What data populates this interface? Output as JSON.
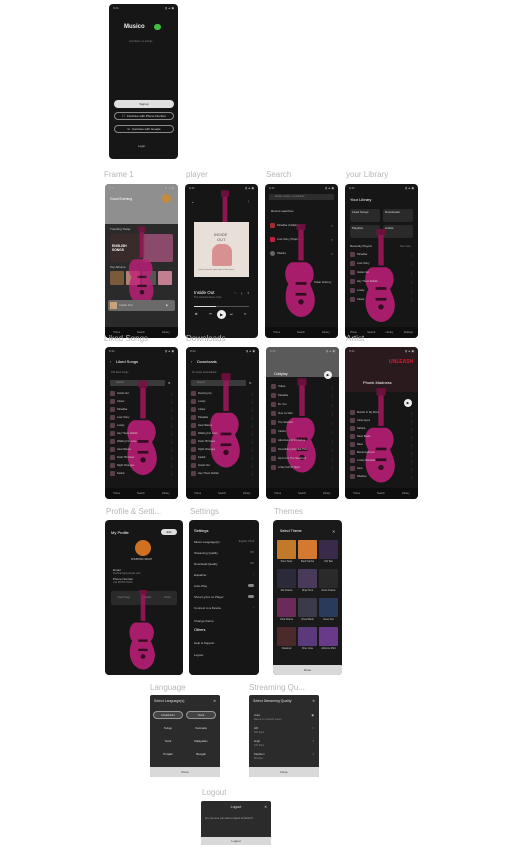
{
  "status": {
    "time": "9:41",
    "icons": "▮ ▲ ◼"
  },
  "frame1": {
    "app_name": "Musico",
    "tagline": "Just listen, no strings",
    "signup": "Signup",
    "continue_phone": "Continue with Phone Number",
    "continue_google": "Continue with Google",
    "login": "Login"
  },
  "labels": {
    "frame1": "Frame 1",
    "player": "player",
    "search": "Search",
    "library": "your Library",
    "liked": "Liked Songs",
    "downloads": "Downloads",
    "artist": "Artist",
    "profile": "Profile  & Setti...",
    "settings": "Settings",
    "themes": "Themes",
    "language": "Language",
    "streaming": "Streaming Qu...",
    "logout": "Logout"
  },
  "home": {
    "greeting": "Good Evening",
    "section1": "Trending Today",
    "section2": "Top Albums",
    "promo": "ENGLISH SONGS",
    "now_playing": "Inside Out",
    "nav": [
      "Home",
      "Search",
      "Library"
    ]
  },
  "player": {
    "album_line1": "INSIDE",
    "album_line2": "OUT",
    "album_caption": "Let me into the dark side of the moon",
    "title": "Inside Out",
    "artist": "The Chainsmokers, Cha..."
  },
  "search": {
    "placeholder": "Artists, songs, or podcasts",
    "recent": "Recent searches",
    "items": [
      "Paradise (Coldplay)",
      "Love Story (Taylor S...)",
      "Shakira"
    ],
    "clear": "Clear History",
    "nav": [
      "Home",
      "Search",
      "Library"
    ]
  },
  "library": {
    "title": "Your Library",
    "cards": [
      "Liked Songs",
      "Downloads",
      "Playlists",
      "Artists"
    ],
    "recent": "Recently Played",
    "see_more": "See more",
    "items": [
      "Paradise",
      "Love Story",
      "Inside Out",
      "Hey There Delilah",
      "Lovely",
      "Closer"
    ],
    "nav": [
      "Home",
      "Search",
      "Library",
      "Settings"
    ]
  },
  "liked": {
    "title": "Liked Songs",
    "count": "100 liked songs",
    "search": "Search",
    "items": [
      "Inside Out",
      "Closer",
      "Paradise",
      "Love Story",
      "Lovely",
      "Hey There Delilah",
      "Waiting For Love",
      "Heat Waves",
      "Dusk Till Dawn",
      "Night Changes",
      "Faded"
    ]
  },
  "downloads": {
    "title": "Downloads",
    "count": "20 songs downloaded",
    "search": "Search",
    "items": [
      "Running Up",
      "Lovely",
      "Closer",
      "Paradise",
      "Heat Waves",
      "Waiting For Love",
      "Dusk Till Dawn",
      "Night Changes",
      "Faded",
      "Inside Out",
      "Hey There Delilah"
    ]
  },
  "artist": {
    "name": "Coldplay",
    "items": [
      "Yellow",
      "Paradise",
      "Fix You",
      "Viva La Vida",
      "The Scientist",
      "Clocks",
      "Adventure Of A Lifetime",
      "Something Just Like This",
      "Hymn For The Weekend",
      "A Sky Full Of Stars"
    ]
  },
  "artist2": {
    "name": "Phonk Madness",
    "banner": "UNLEASH",
    "items": [
      "Murder In My Mind",
      "Close Eyes",
      "Sahara",
      "Neon Blade",
      "Rave",
      "Metamorphosis",
      "Lovely Bastards",
      "Aura",
      "Shadow"
    ]
  },
  "profile": {
    "title": "My Profile",
    "edit": "Edit",
    "name": "SHUBHAM SINGH",
    "email_label": "Email",
    "email": "shubham@example.com",
    "phone_label": "Phone Number",
    "phone": "+91 98765 43210",
    "stats": [
      "Liked Songs",
      "Playlists",
      "Artists"
    ]
  },
  "settings": {
    "title": "Settings",
    "items": [
      {
        "label": "Music Language(s)",
        "value": "English, Hindi"
      },
      {
        "label": "Streaming Quality",
        "value": "HD"
      },
      {
        "label": "Download Quality",
        "value": "HD"
      },
      {
        "label": "Equalizer",
        "value": "›"
      },
      {
        "label": "Auto-Play",
        "value": ""
      },
      {
        "label": "Show Lyrics on Player",
        "value": ""
      },
      {
        "label": "Connect to a Device",
        "value": "›"
      },
      {
        "label": "Change theme",
        "value": ""
      }
    ],
    "others": "Others",
    "help": "Help & Support",
    "logout": "Logout"
  },
  "themes": {
    "title": "Select Theme",
    "items": [
      "Shun Suite",
      "Bank Sacha",
      "Old Tale",
      "Mix Drama",
      "Ninja Hunt",
      "Retro Drama",
      "Ultra Drama",
      "Ghost Bank",
      "Neon Fist",
      "Classical",
      "Chex Jose",
      "Airborne Pilot"
    ],
    "done": "Done"
  },
  "language": {
    "title": "Select Language(s)",
    "items": [
      "Hindi/Urdu",
      "Tamil",
      "Telugu",
      "Kannada",
      "Tamil",
      "Malayalam",
      "Punjabi",
      "Bengali"
    ],
    "done": "Done"
  },
  "streaming": {
    "title": "Select Streaming Quality",
    "items": [
      {
        "label": "Auto",
        "desc": "Based on network speed"
      },
      {
        "label": "HD",
        "desc": "320 kbps"
      },
      {
        "label": "High",
        "desc": "160 kbps"
      },
      {
        "label": "Medium",
        "desc": "96 kbps"
      }
    ],
    "done": "Done"
  },
  "logout": {
    "title": "Logout",
    "text": "Are you sure you want to logout of Musico?",
    "button": "Logout"
  },
  "colors": {
    "accent": "#c21f7a",
    "green": "#3cc13c",
    "bg": "#161616"
  }
}
